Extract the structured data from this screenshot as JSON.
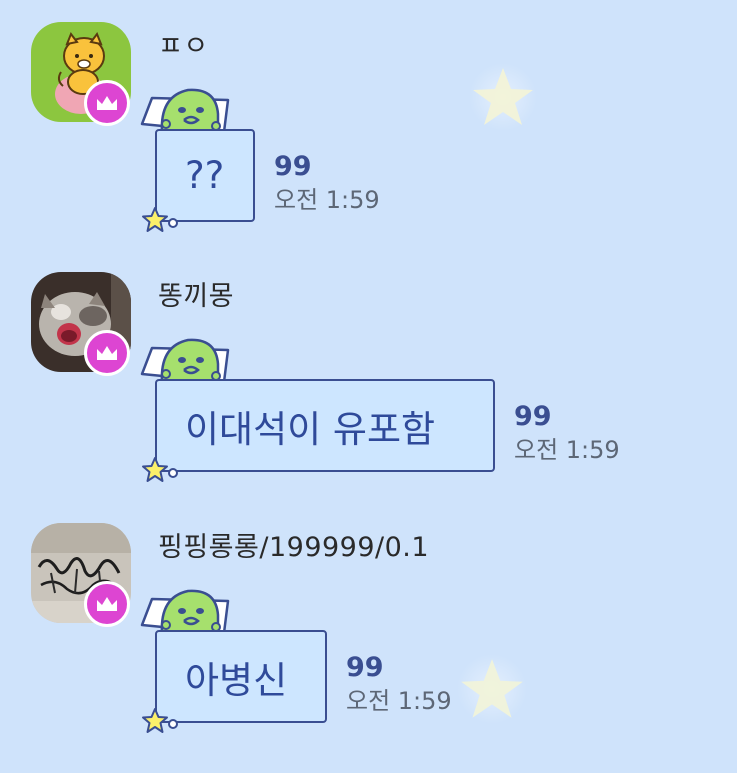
{
  "colors": {
    "background": "#cfe3fb",
    "bubble_fill": "#cde6ff",
    "bubble_border": "#3a4e91",
    "bubble_text": "#2f4a9a",
    "crown_badge": "#dd45d2",
    "count_text": "#3a4e91",
    "time_text": "#5d6776"
  },
  "messages": [
    {
      "sender": "ㅍㅇ",
      "avatar_icon": "cat-character-avatar-icon",
      "badge_icon": "crown-icon",
      "text": "??",
      "unread_count": "99",
      "time": "오전 1:59"
    },
    {
      "sender": "똥끼몽",
      "avatar_icon": "yawning-cat-photo-avatar-icon",
      "badge_icon": "crown-icon",
      "text": "이대석이 유포함",
      "unread_count": "99",
      "time": "오전 1:59"
    },
    {
      "sender": "핑핑롱롱/199999/0.1",
      "avatar_icon": "graffiti-photo-avatar-icon",
      "badge_icon": "crown-icon",
      "text": "아병신",
      "unread_count": "99",
      "time": "오전 1:59"
    }
  ],
  "decorations": {
    "bubble_sticker_icon": "green-blob-pillow-sticker-icon",
    "bubble_corner_icon": "yellow-star-icon",
    "background_icon": "pale-star-icon"
  }
}
